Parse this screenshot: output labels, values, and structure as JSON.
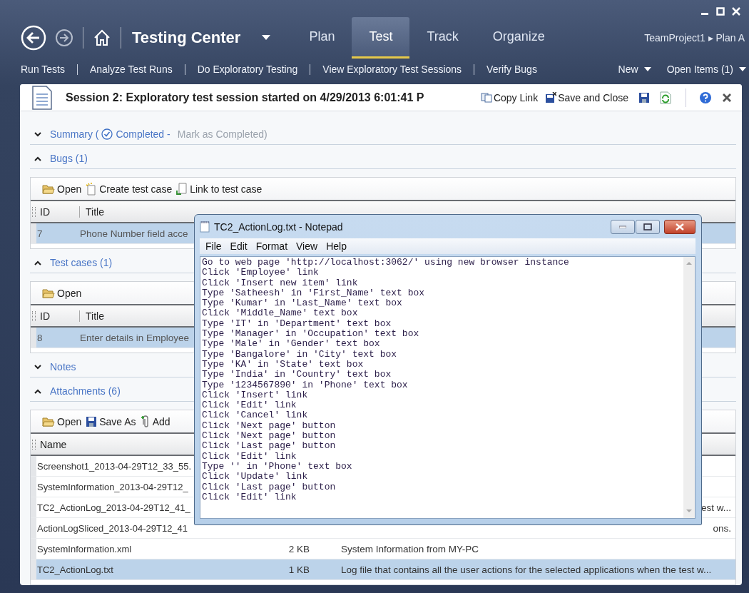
{
  "app": {
    "title": "Testing Center",
    "tabs": [
      {
        "label": "Plan",
        "selected": false
      },
      {
        "label": "Test",
        "selected": true
      },
      {
        "label": "Track",
        "selected": false
      },
      {
        "label": "Organize",
        "selected": false
      }
    ],
    "breadcrumb": "TeamProject1 ▸ Plan A"
  },
  "nav_links": [
    "Run Tests",
    "Analyze Test Runs",
    "Do Exploratory Testing",
    "View Exploratory Test Sessions",
    "Verify Bugs"
  ],
  "nav_menus": [
    "New",
    "Open Items (1)"
  ],
  "session": {
    "title": "Session 2: Exploratory test session started on 4/29/2013 6:01:41 P",
    "actions": [
      "Copy Link",
      "Save and Close"
    ]
  },
  "sections": [
    {
      "kind": "summary",
      "label": "Summary (",
      "status": "Completed -",
      "action": "Mark as Completed)",
      "expanded": false
    },
    {
      "kind": "list",
      "label": "Bugs (1)",
      "expanded": true,
      "toolbar": [
        {
          "kind": "open",
          "label": "Open"
        },
        {
          "kind": "create",
          "label": "Create test case"
        },
        {
          "kind": "link",
          "label": "Link to test case"
        }
      ],
      "columns": [
        "ID",
        "Title"
      ],
      "rows": [
        {
          "id": "7",
          "title": "Phone Number field acce",
          "selected": true
        }
      ]
    },
    {
      "kind": "list",
      "label": "Test cases (1)",
      "expanded": true,
      "toolbar": [
        {
          "kind": "open",
          "label": "Open"
        }
      ],
      "columns": [
        "ID",
        "Title"
      ],
      "rows": [
        {
          "id": "8",
          "title": "Enter details in Employee",
          "selected": true
        }
      ]
    },
    {
      "kind": "notes",
      "label": "Notes",
      "expanded": false
    },
    {
      "kind": "attachments",
      "label": "Attachments (6)",
      "expanded": true,
      "toolbar": [
        {
          "kind": "open",
          "label": "Open"
        },
        {
          "kind": "save",
          "label": "Save As"
        },
        {
          "kind": "add",
          "label": "Add"
        }
      ],
      "columns": [
        "Name"
      ],
      "rows": [
        {
          "name": "Screenshot1_2013-04-29T12_33_55.",
          "selected": false
        },
        {
          "name": "SystemInformation_2013-04-29T12_",
          "selected": false
        },
        {
          "name": "TC2_ActionLog_2013-04-29T12_41_",
          "comment": "est w...",
          "comment_cut": true,
          "selected": false
        },
        {
          "name": "ActionLogSliced_2013-04-29T12_41",
          "comment": "ons.",
          "comment_cut": true,
          "selected": false
        },
        {
          "name": "SystemInformation.xml",
          "size": "2 KB",
          "comment": "System Information from MY-PC",
          "comment_cut": false,
          "selected": false
        },
        {
          "name": "TC2_ActionLog.txt",
          "size": "1 KB",
          "comment": "Log file that contains all the user actions for the selected applications when the test w...",
          "comment_cut": false,
          "selected": true
        }
      ]
    }
  ],
  "notepad": {
    "title": "TC2_ActionLog.txt - Notepad",
    "menu": [
      "File",
      "Edit",
      "Format",
      "View",
      "Help"
    ],
    "lines": [
      "Go to web page 'http://localhost:3062/' using new browser instance",
      "Click 'Employee' link",
      "Click 'Insert new item' link",
      "Type 'Satheesh' in 'First_Name' text box",
      "Type 'Kumar' in 'Last_Name' text box",
      "Click 'Middle_Name' text box",
      "Type 'IT' in 'Department' text box",
      "Type 'Manager' in 'Occupation' text box",
      "Type 'Male' in 'Gender' text box",
      "Type 'Bangalore' in 'City' text box",
      "Type 'KA' in 'State' text box",
      "Type 'India' in 'Country' text box",
      "Type '1234567890' in 'Phone' text box",
      "Click 'Insert' link",
      "Click 'Edit' link",
      "Click 'Cancel' link",
      "Click 'Next page' button",
      "Click 'Next page' button",
      "Click 'Last page' button",
      "Click 'Edit' link",
      "Type '' in 'Phone' text box",
      "Click 'Update' link",
      "Click 'Last page' button",
      "Click 'Edit' link"
    ]
  }
}
